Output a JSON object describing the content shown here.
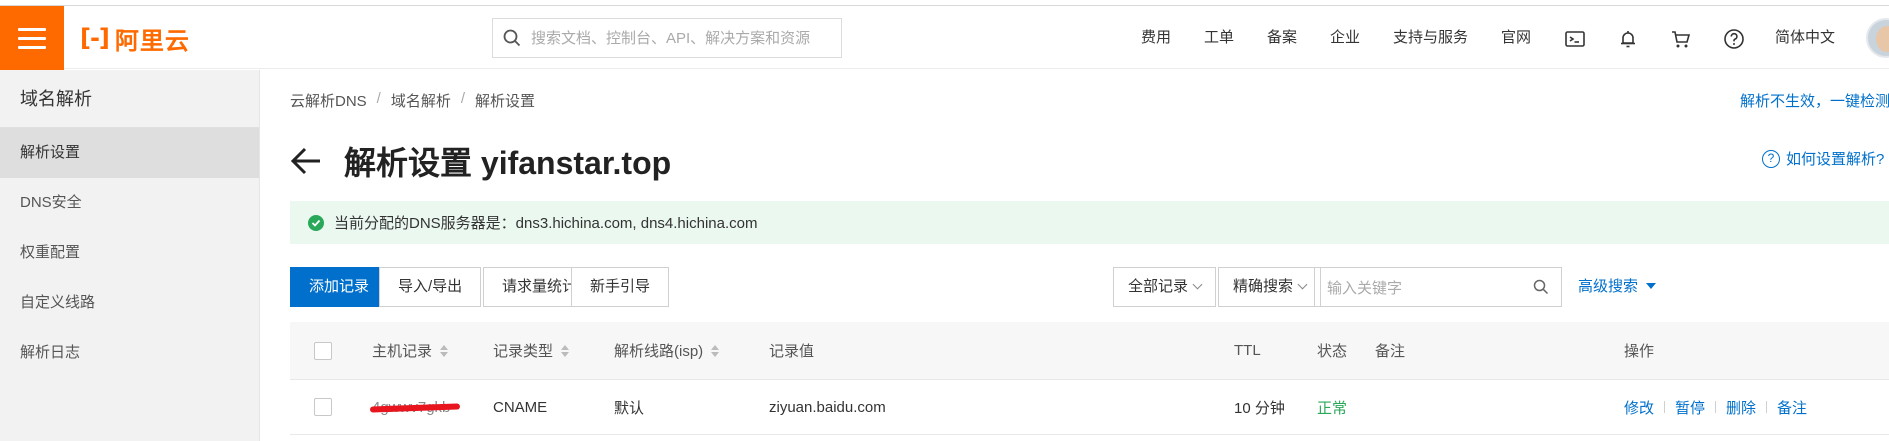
{
  "topbar": {
    "logo_text": "阿里云",
    "search_placeholder": "搜索文档、控制台、API、解决方案和资源",
    "nav": [
      "费用",
      "工单",
      "备案",
      "企业",
      "支持与服务",
      "官网"
    ],
    "language": "简体中文"
  },
  "sidebar": {
    "title": "域名解析",
    "items": [
      {
        "label": "解析设置",
        "active": true
      },
      {
        "label": "DNS安全",
        "active": false
      },
      {
        "label": "权重配置",
        "active": false
      },
      {
        "label": "自定义线路",
        "active": false
      },
      {
        "label": "解析日志",
        "active": false
      }
    ]
  },
  "main": {
    "breadcrumb": [
      "云解析DNS",
      "域名解析",
      "解析设置"
    ],
    "top_right_link": "解析不生效，一键检测",
    "title": "解析设置 yifanstar.top",
    "help_link": "如何设置解析?",
    "notice": "当前分配的DNS服务器是：dns3.hichina.com, dns4.hichina.com",
    "toolbar": {
      "add_record": "添加记录",
      "import_export": "导入/导出",
      "request_stats": "请求量统计",
      "beginner_guide": "新手引导",
      "record_filter": "全部记录",
      "search_mode": "精确搜索",
      "keyword_placeholder": "输入关键字",
      "advanced_search": "高级搜索"
    },
    "table": {
      "headers": {
        "host": "主机记录",
        "type": "记录类型",
        "line": "解析线路(isp)",
        "value": "记录值",
        "ttl": "TTL",
        "status": "状态",
        "remark": "备注",
        "actions": "操作"
      },
      "rows": [
        {
          "host": "4gwwv7gkb",
          "type": "CNAME",
          "line": "默认",
          "value": "ziyuan.baidu.com",
          "ttl": "10 分钟",
          "status": "正常",
          "remark": "",
          "actions": [
            "修改",
            "暂停",
            "删除",
            "备注"
          ]
        }
      ]
    }
  },
  "colors": {
    "brand": "#ff6a00",
    "link": "#0070cc",
    "success": "#2aa85a",
    "notice_bg": "#ebf8f0"
  }
}
